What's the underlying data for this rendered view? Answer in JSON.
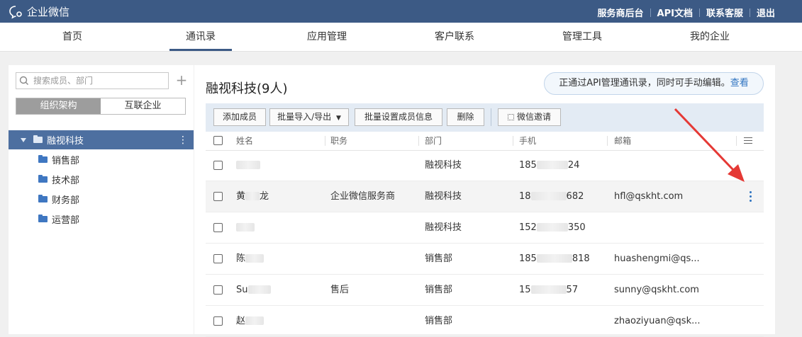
{
  "app": {
    "name": "企业微信"
  },
  "header_links": [
    "服务商后台",
    "API文档",
    "联系客服",
    "退出"
  ],
  "nav_tabs": [
    "首页",
    "通讯录",
    "应用管理",
    "客户联系",
    "管理工具",
    "我的企业"
  ],
  "nav_active": "通讯录",
  "sidebar": {
    "search_placeholder": "搜索成员、部门",
    "add_symbol": "+",
    "segments": [
      "组织架构",
      "互联企业"
    ],
    "active_segment": "组织架构",
    "root": "融视科技",
    "root_menu": "⋮",
    "departments": [
      "销售部",
      "技术部",
      "财务部",
      "运营部"
    ]
  },
  "main": {
    "title": "融视科技(9人)",
    "notice_text": "正通过API管理通讯录，同时可手动编辑。",
    "notice_link": "查看",
    "toolbar": {
      "add_member": "添加成员",
      "import_export": "批量导入/导出",
      "batch_set": "批量设置成员信息",
      "delete": "删除",
      "wechat_invite": "微信邀请"
    },
    "columns": [
      "姓名",
      "职务",
      "部门",
      "手机",
      "邮箱"
    ],
    "rows": [
      {
        "name_pre": "",
        "name_post": "",
        "position": "",
        "dept": "融视科技",
        "phone_pre": "185",
        "phone_post": "24",
        "email": ""
      },
      {
        "name_pre": "黄",
        "name_post": "龙",
        "position": "企业微信服务商",
        "dept": "融视科技",
        "phone_pre": "18",
        "phone_post": "682",
        "email": "hfl@qskht.com"
      },
      {
        "name_pre": "",
        "name_post": "",
        "position": "",
        "dept": "融视科技",
        "phone_pre": "152",
        "phone_post": "350",
        "email": ""
      },
      {
        "name_pre": "陈",
        "name_post": "",
        "position": "",
        "dept": "销售部",
        "phone_pre": "185",
        "phone_post": "818",
        "email": "huashengmi@qs..."
      },
      {
        "name_pre": "Su",
        "name_post": "",
        "position": "售后",
        "dept": "销售部",
        "phone_pre": "15",
        "phone_post": "57",
        "email": "sunny@qskht.com"
      },
      {
        "name_pre": "赵",
        "name_post": "",
        "position": "",
        "dept": "销售部",
        "phone_pre": "",
        "phone_post": "",
        "email": "zhaoziyuan@qsk..."
      }
    ]
  },
  "colors": {
    "brand": "#3c5a85",
    "sidebar_selected": "#4d6fa0",
    "toolbar_bg": "#e3ebf4",
    "link": "#2e73c0",
    "arrow": "#e53935"
  },
  "icons": [
    "logo-chat-icon",
    "search-icon",
    "caret-down-icon",
    "folder-icon",
    "grid-icon",
    "column-settings-icon",
    "more-vertical-icon"
  ]
}
